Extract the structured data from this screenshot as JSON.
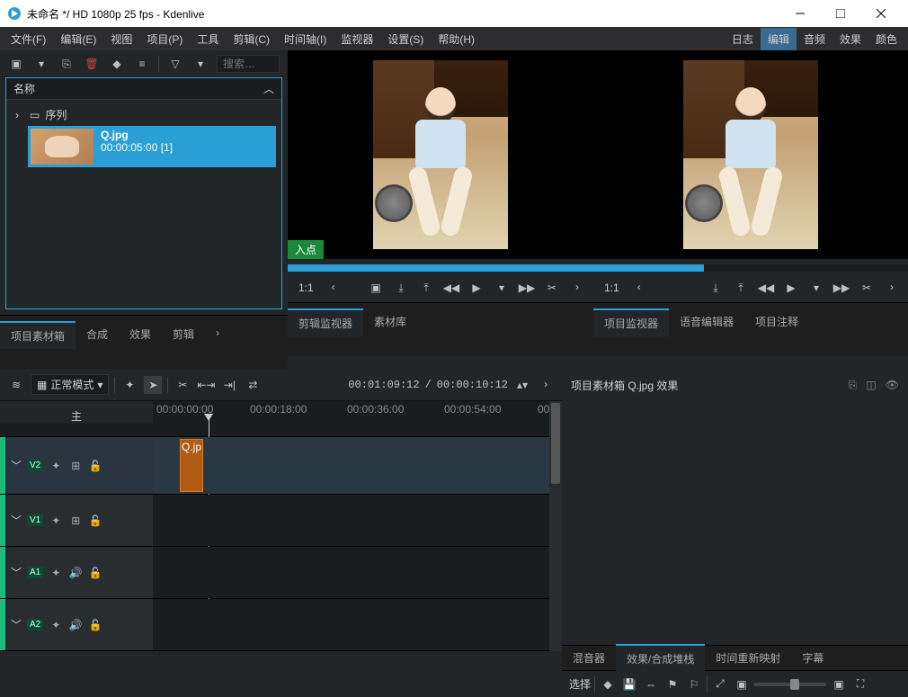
{
  "titlebar": {
    "title": "未命名 */ HD 1080p 25 fps - Kdenlive"
  },
  "menu": {
    "file": "文件(F)",
    "edit": "编辑(E)",
    "view": "视图",
    "project": "项目(P)",
    "tool": "工具",
    "clip": "剪辑(C)",
    "timeline": "时间轴(I)",
    "monitor": "监视器",
    "settings": "设置(S)",
    "help": "帮助(H)"
  },
  "rtabs": {
    "log": "日志",
    "edit": "编辑",
    "audio": "音频",
    "effect": "效果",
    "color": "颜色"
  },
  "bin": {
    "header": "名称",
    "search_placeholder": "搜索…",
    "seq": "序列",
    "clip": {
      "name": "Q.jpg",
      "meta": "00:00:05:00 [1]"
    }
  },
  "monitor": {
    "inpoint": "入点",
    "zoom": "1:1"
  },
  "panel_tabs_left": {
    "bin": "项目素材箱",
    "compose": "合成",
    "effect": "效果",
    "clipprop": "剪辑"
  },
  "panel_tabs_center": {
    "clipmon": "剪辑监视器",
    "medialib": "素材库"
  },
  "panel_tabs_right": {
    "projmon": "项目监视器",
    "voice": "语音编辑器",
    "notes": "项目注释"
  },
  "timeline_tb": {
    "mode": "正常模式",
    "tc1": "00:01:09:12",
    "tc2": "00:00:10:12"
  },
  "ruler": {
    "master": "主",
    "t0": "00:00:00:00",
    "t1": "00:00:18:00",
    "t2": "00:00:36:00",
    "t3": "00:00:54:00",
    "t4": "00"
  },
  "tracks": {
    "v2": "V2",
    "v1": "V1",
    "a1": "A1",
    "a2": "A2",
    "clip_label": "Q.jp"
  },
  "effect_panel": {
    "title": "项目素材箱 Q.jpg 效果"
  },
  "bottom_tabs": {
    "mixer": "混音器",
    "stack": "效果/合成堆栈",
    "remap": "时间重新映射",
    "subtitle": "字幕"
  },
  "bottom_bar": {
    "select": "选择"
  }
}
